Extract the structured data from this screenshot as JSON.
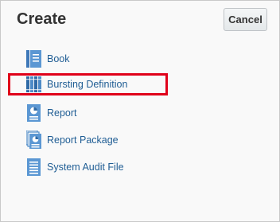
{
  "dialog": {
    "title": "Create",
    "cancel_label": "Cancel"
  },
  "items": [
    {
      "label": "Book",
      "icon": "book-icon"
    },
    {
      "label": "Bursting Definition",
      "icon": "bursting-definition-icon"
    },
    {
      "label": "Report",
      "icon": "report-icon"
    },
    {
      "label": "Report Package",
      "icon": "report-package-icon"
    },
    {
      "label": "System Audit File",
      "icon": "audit-file-icon"
    }
  ],
  "colors": {
    "link": "#1f5d94",
    "icon": "#4e8bc7",
    "highlight": "#e0001a"
  }
}
